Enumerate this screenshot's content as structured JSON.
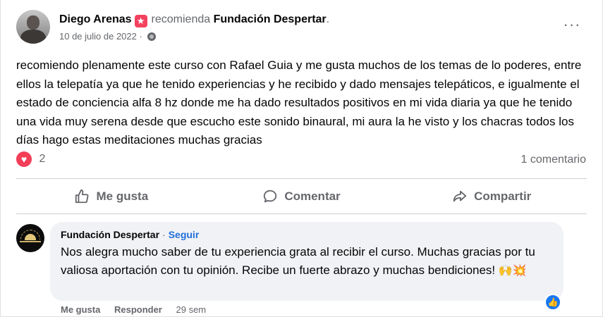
{
  "post": {
    "author": "Diego Arenas",
    "verb": "recomienda",
    "page": "Fundación Despertar",
    "page_suffix": ".",
    "date": "10 de julio de 2022 ·",
    "more_label": "···",
    "text": "recomiendo plenamente este curso con Rafael Guia y me gusta muchos de los temas de lo poderes, entre ellos la telepatía ya que he tenido experiencias y he  recibido y dado  mensajes telepáticos,  e igualmente el estado de conciencia alfa 8 hz donde me ha dado resultados positivos en mi vida diaria ya que he tenido una vida muy serena desde que escucho este sonido binaural, mi aura la he visto y los chacras todos los días hago estas meditaciones muchas gracias",
    "reaction_count": "2",
    "comment_count": "1 comentario"
  },
  "actions": {
    "like": "Me gusta",
    "comment": "Comentar",
    "share": "Compartir"
  },
  "comment": {
    "author": "Fundación Despertar",
    "separator": "·",
    "follow": "Seguir",
    "text": "Nos alegra mucho saber de tu experiencia grata al recibir el curso. Muchas gracias por tu valiosa aportación con tu opinión. Recibe un fuerte abrazo y muchas bendiciones!",
    "emoji": "🙌💥",
    "like": "Me gusta",
    "reply": "Responder",
    "time": "29 sem"
  },
  "icons": {
    "recommend": "star-tag-icon",
    "privacy": "globe-icon",
    "reaction": "heart-icon",
    "like": "thumbs-up-icon",
    "comment": "speech-bubble-icon",
    "share": "share-arrow-icon",
    "comment_like": "blue-like-icon"
  },
  "colors": {
    "accent": "#216fdb",
    "heart": "#f33e58",
    "recommend": "#f3425f",
    "like_blue": "#1877f2",
    "muted_text": "#65676b",
    "bubble_bg": "#f0f2f5"
  }
}
